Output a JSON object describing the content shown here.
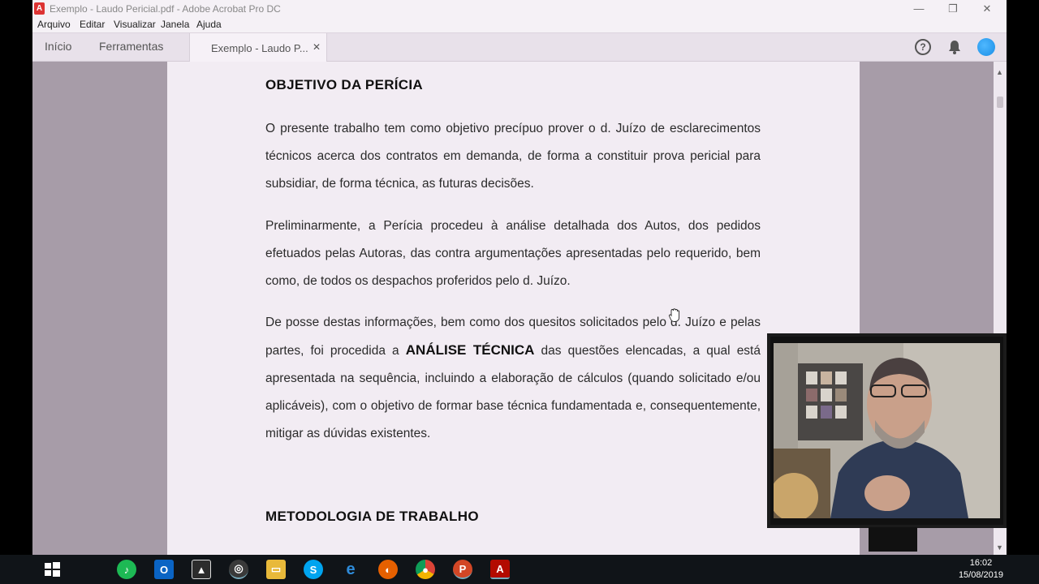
{
  "window": {
    "title": "Exemplo - Laudo Pericial.pdf - Adobe Acrobat Pro DC",
    "controls": {
      "minimize": "—",
      "maximize": "❐",
      "close": "✕"
    }
  },
  "menu": [
    "Arquivo",
    "Editar",
    "Visualizar",
    "Janela",
    "Ajuda"
  ],
  "tabs": {
    "home": "Início",
    "tools": "Ferramentas",
    "document": "Exemplo - Laudo P...",
    "document_close": "✕"
  },
  "toolbar_icons": {
    "help": "?",
    "help_icon": "help-icon",
    "bell_icon": "bell-icon",
    "avatar_icon": "avatar-icon"
  },
  "document": {
    "heading_1": "OBJETIVO DA PERÍCIA",
    "paragraph_1": "O presente trabalho tem como objetivo precípuo prover o d. Juízo de esclarecimentos técnicos acerca dos contratos em demanda, de forma a constituir prova pericial para subsidiar, de forma técnica, as futuras decisões.",
    "paragraph_2": "Preliminarmente, a Perícia procedeu à análise detalhada dos Autos, dos pedidos efetuados pelas Autoras, das contra argumentações apresentadas pelo requerido, bem como, de todos os despachos proferidos pelo d. Juízo.",
    "paragraph_3_before": "De posse destas informações, bem como dos quesitos solicitados pelo d. Juízo e pelas partes, foi procedida a ",
    "paragraph_3_bold": "ANÁLISE TÉCNICA",
    "paragraph_3_after": " das questões elencadas, a qual está apresentada na sequência, incluindo a elaboração de cálculos (quando solicitado e/ou aplicáveis), com o objetivo de formar base técnica fundamentada e, consequentemente, mitigar as dúvidas existentes.",
    "heading_2": "METODOLOGIA DE TRABALHO"
  },
  "taskbar": {
    "time": "16:02",
    "date": "15/08/2019",
    "apps": [
      "windows-start-icon",
      "spotify-icon",
      "outlook-icon",
      "photos-icon",
      "obs-icon",
      "file-explorer-icon",
      "skype-icon",
      "edge-icon",
      "firefox-icon",
      "chrome-icon",
      "powerpoint-icon",
      "acrobat-icon"
    ]
  },
  "colors": {
    "page": "#f2ecf3",
    "viewer_bg": "#a79ca8",
    "taskbar": "#101418",
    "accent_avatar": "#1a8ee6"
  }
}
